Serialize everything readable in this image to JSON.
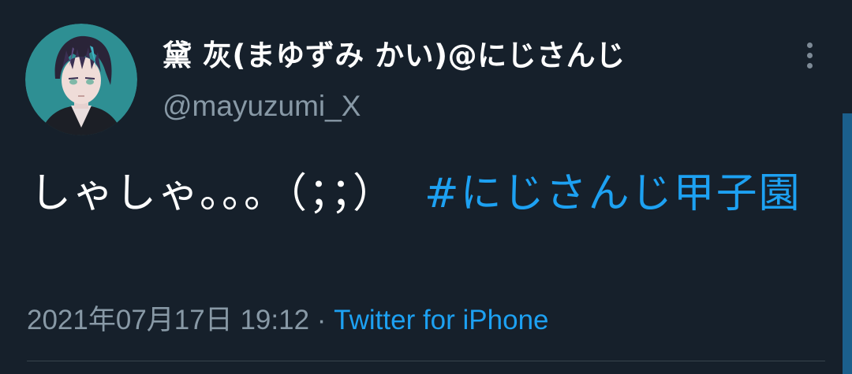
{
  "tweet": {
    "display_name": "黛 灰(まゆずみ かい)@にじさんじ",
    "handle": "@mayuzumi_X",
    "text_main": "しゃしゃ。。。（；；）",
    "spacer": "  ",
    "hashtag": "#にじさんじ甲子園",
    "timestamp": "2021年07月17日 19:12",
    "separator": " · ",
    "source": "Twitter for iPhone"
  },
  "icons": {
    "more": "more-vertical-icon",
    "avatar": "user-avatar"
  },
  "colors": {
    "background": "#16202b",
    "link": "#1da1f2",
    "secondary_text": "#8899a6",
    "primary_text": "#ffffff"
  }
}
